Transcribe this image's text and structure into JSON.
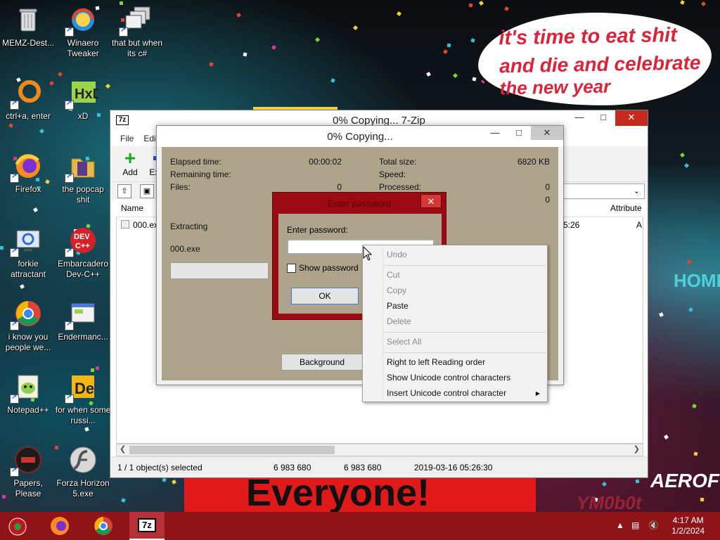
{
  "desktop": {
    "meme_lines": [
      "it's time to eat shit",
      "and die and celebrate",
      "the new year"
    ],
    "poster_text": "Everyone!",
    "bg_text_1": "YM0b0t",
    "bg_text_2": "AEROFOS",
    "bg_text_3": "HOME",
    "icons": [
      {
        "label": "MEMZ-Dest..."
      },
      {
        "label": "Winaero Tweaker"
      },
      {
        "label": "that but when its c#"
      },
      {
        "label": "ctrl+a, enter"
      },
      {
        "label": "xD"
      },
      {
        "label": "Firefox"
      },
      {
        "label": "the popcap shit"
      },
      {
        "label": "forkie attractant"
      },
      {
        "label": "Embarcadero Dev-C++"
      },
      {
        "label": "i know you people we..."
      },
      {
        "label": "Endermanc..."
      },
      {
        "label": "Notepad++"
      },
      {
        "label": "for when some russi..."
      },
      {
        "label": "Papers, Please"
      },
      {
        "label": "Forza Horizon 5.exe"
      }
    ]
  },
  "zip_window": {
    "title": "0% Copying... 7-Zip",
    "icon_text": "7z",
    "menu": [
      "File",
      "Edit"
    ],
    "toolbar": {
      "add": "Add",
      "extract": "Ext"
    },
    "columns": {
      "name": "Name",
      "attributes": "Attribute"
    },
    "rows": [
      {
        "name": "000.exe",
        "time_fragment": "5:26",
        "attr_fragment": "A"
      }
    ],
    "status": {
      "selected": "1 / 1 object(s) selected",
      "size": "6 983 680",
      "packed": "6 983 680",
      "modified": "2019-03-16 05:26:30"
    }
  },
  "progress_dialog": {
    "title": "0% Copying...",
    "elapsed_label": "Elapsed time:",
    "elapsed_value": "00:00:02",
    "remaining_label": "Remaining time:",
    "files_label": "Files:",
    "files_value": "0",
    "total_size_label": "Total size:",
    "total_size_value": "6820 KB",
    "speed_label": "Speed:",
    "processed_label": "Processed:",
    "processed_value": "0",
    "extra_value": "0",
    "extracting_label": "Extracting",
    "current_file": "000.exe",
    "background_button": "Background"
  },
  "password_dialog": {
    "title": "Enter password",
    "prompt": "Enter password:",
    "input_value": "",
    "show_password": "Show password",
    "ok": "OK"
  },
  "context_menu": {
    "undo": "Undo",
    "cut": "Cut",
    "copy": "Copy",
    "paste": "Paste",
    "delete": "Delete",
    "select_all": "Select All",
    "rtl": "Right to left Reading order",
    "show_unicode": "Show Unicode control characters",
    "insert_unicode": "Insert Unicode control character"
  },
  "taskbar": {
    "time": "4:17 AM",
    "date": "1/2/2024",
    "active_app_label": "7z"
  }
}
